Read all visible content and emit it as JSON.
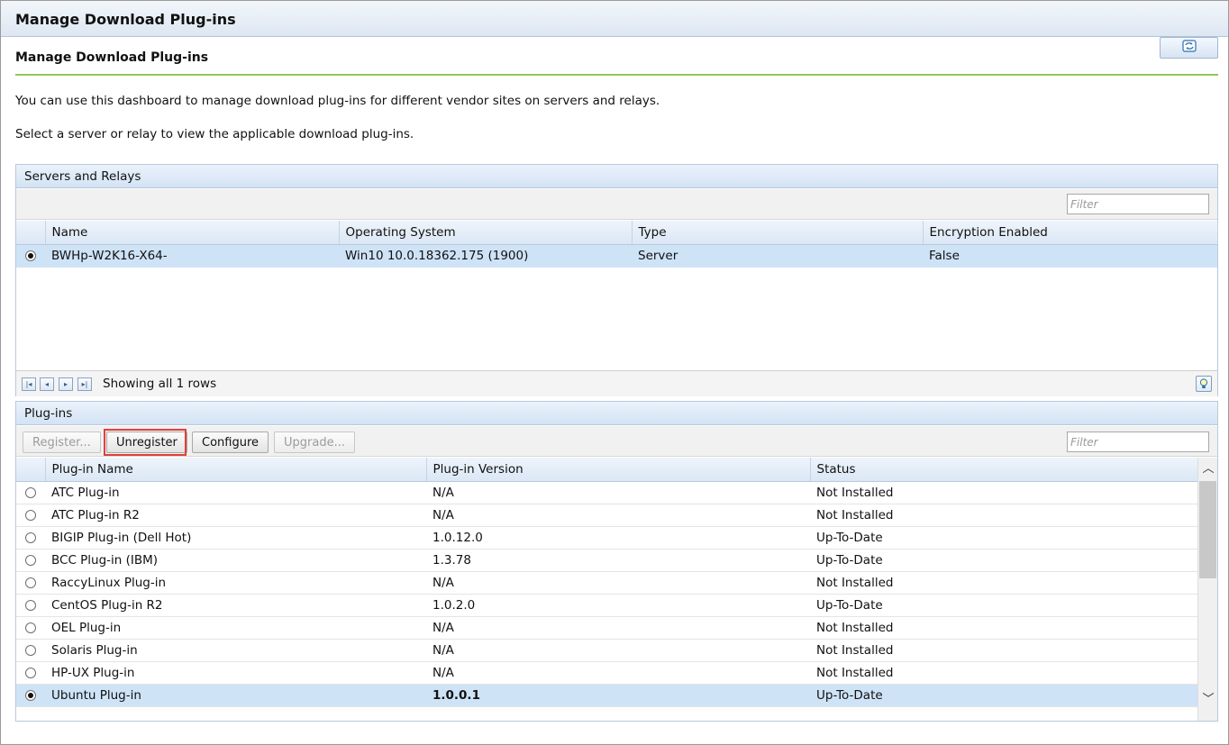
{
  "window": {
    "title": "Manage Download Plug-ins"
  },
  "page": {
    "heading": "Manage Download Plug-ins",
    "intro_line1": "You can use this dashboard to manage download plug-ins for different vendor sites on servers and relays.",
    "intro_line2": "Select a server or relay to view the applicable download plug-ins.",
    "refresh_icon": "refresh-icon"
  },
  "servers_panel": {
    "title": "Servers and Relays",
    "filter_placeholder": "Filter",
    "columns": [
      "Name",
      "Operating System",
      "Type",
      "Encryption Enabled"
    ],
    "rows": [
      {
        "selected": true,
        "name": "BWHp-W2K16-X64-",
        "os": "Win10 10.0.18362.175 (1900)",
        "type": "Server",
        "encryption": "False"
      }
    ],
    "pager_text": "Showing all 1 rows",
    "pager_icons": [
      "first-page-icon",
      "prev-page-icon",
      "next-page-icon",
      "last-page-icon"
    ],
    "help_icon": "lightbulb-icon"
  },
  "plugins_panel": {
    "title": "Plug-ins",
    "buttons": {
      "register": "Register...",
      "unregister": "Unregister",
      "configure": "Configure",
      "upgrade": "Upgrade..."
    },
    "filter_placeholder": "Filter",
    "columns": [
      "Plug-in Name",
      "Plug-in Version",
      "Status"
    ],
    "rows": [
      {
        "selected": false,
        "name": "ATC Plug-in",
        "version": "N/A",
        "status": "Not Installed"
      },
      {
        "selected": false,
        "name": "ATC Plug-in R2",
        "version": "N/A",
        "status": "Not Installed"
      },
      {
        "selected": false,
        "name": "BIGIP Plug-in (Dell Hot)",
        "version": "1.0.12.0",
        "status": "Up-To-Date"
      },
      {
        "selected": false,
        "name": "BCC Plug-in (IBM)",
        "version": "1.3.78",
        "status": "Up-To-Date"
      },
      {
        "selected": false,
        "name": "RaccyLinux Plug-in",
        "version": "N/A",
        "status": "Not Installed"
      },
      {
        "selected": false,
        "name": "CentOS Plug-in R2",
        "version": "1.0.2.0",
        "status": "Up-To-Date"
      },
      {
        "selected": false,
        "name": "OEL Plug-in",
        "version": "N/A",
        "status": "Not Installed"
      },
      {
        "selected": false,
        "name": "Solaris Plug-in",
        "version": "N/A",
        "status": "Not Installed"
      },
      {
        "selected": false,
        "name": "HP-UX Plug-in",
        "version": "N/A",
        "status": "Not Installed"
      },
      {
        "selected": true,
        "name": "Ubuntu Plug-in",
        "version": "1.0.0.1",
        "status": "Up-To-Date"
      }
    ]
  },
  "colors": {
    "accent_rule": "#8cc95a",
    "selection": "#cfe3f7",
    "highlight_border": "#e0413a"
  }
}
